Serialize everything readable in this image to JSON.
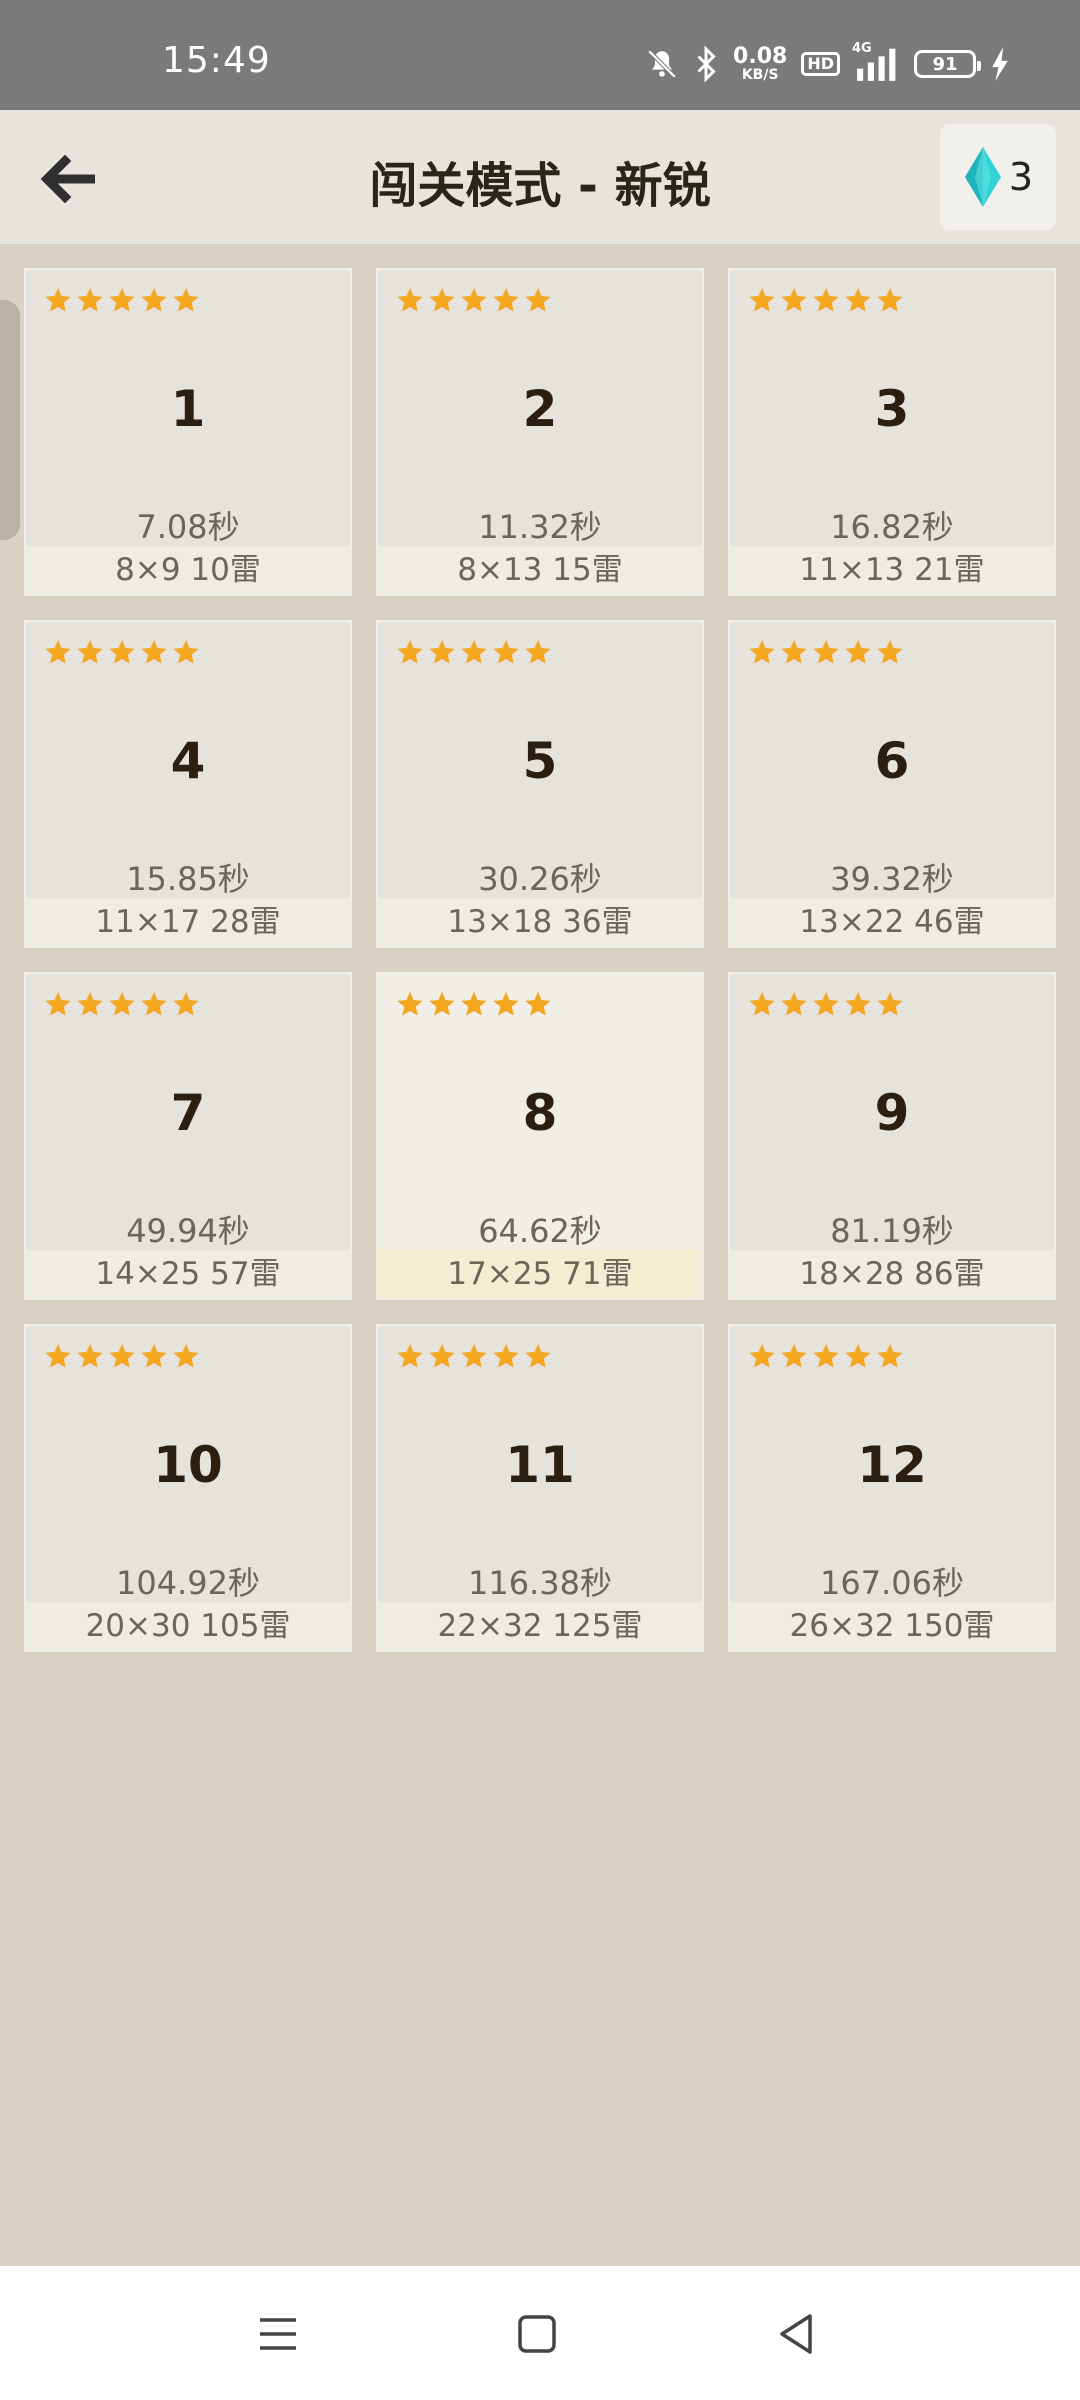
{
  "status_bar": {
    "time": "15:49",
    "net_speed_value": "0.08",
    "net_speed_unit": "KB/S",
    "hd_label": "HD",
    "network_label": "4G",
    "battery": "91"
  },
  "header": {
    "title": "闯关模式 - 新锐",
    "gem_count": "3"
  },
  "colors": {
    "star": "#f5a623",
    "gem": "#2ecbd1",
    "background": "#d8d1c4"
  },
  "levels": [
    {
      "number": "1",
      "stars": 5,
      "time": "7.08秒",
      "info": "8×9  10雷"
    },
    {
      "number": "2",
      "stars": 5,
      "time": "11.32秒",
      "info": "8×13  15雷"
    },
    {
      "number": "3",
      "stars": 5,
      "time": "16.82秒",
      "info": "11×13  21雷"
    },
    {
      "number": "4",
      "stars": 5,
      "time": "15.85秒",
      "info": "11×17  28雷"
    },
    {
      "number": "5",
      "stars": 5,
      "time": "30.26秒",
      "info": "13×18  36雷"
    },
    {
      "number": "6",
      "stars": 5,
      "time": "39.32秒",
      "info": "13×22  46雷"
    },
    {
      "number": "7",
      "stars": 5,
      "time": "49.94秒",
      "info": "14×25  57雷"
    },
    {
      "number": "8",
      "stars": 5,
      "time": "64.62秒",
      "info": "17×25  71雷"
    },
    {
      "number": "9",
      "stars": 5,
      "time": "81.19秒",
      "info": "18×28  86雷"
    },
    {
      "number": "10",
      "stars": 5,
      "time": "104.92秒",
      "info": "20×30  105雷"
    },
    {
      "number": "11",
      "stars": 5,
      "time": "116.38秒",
      "info": "22×32  125雷"
    },
    {
      "number": "12",
      "stars": 5,
      "time": "167.06秒",
      "info": "26×32  150雷"
    }
  ]
}
